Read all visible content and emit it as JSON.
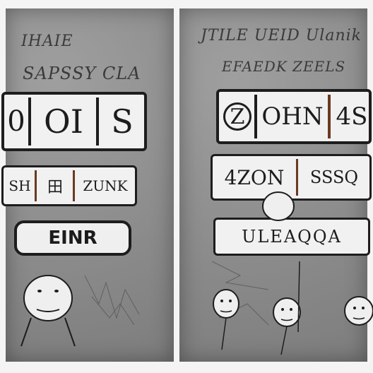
{
  "left_panel": {
    "scribble_top": "IHAIE",
    "scribble_mid": "SAPSSY CLA",
    "top_row": [
      "0",
      "OI",
      "S"
    ],
    "mid_row": [
      "SH",
      "田",
      "ZUNK"
    ],
    "button_label": "EINR"
  },
  "right_panel": {
    "scribble_top": "JTILE UEID Ulanik",
    "scribble_mid": "EFAEDK ZEELS",
    "top_row": [
      "Z",
      "OHN",
      "4S"
    ],
    "mid_row": [
      "4ZON",
      "SSSQ"
    ],
    "lower_label": "ULEAQQA"
  },
  "colors": {
    "panel": "#8e8e8e",
    "ink": "#1d1d1d",
    "paper": "#f1f1f1"
  }
}
